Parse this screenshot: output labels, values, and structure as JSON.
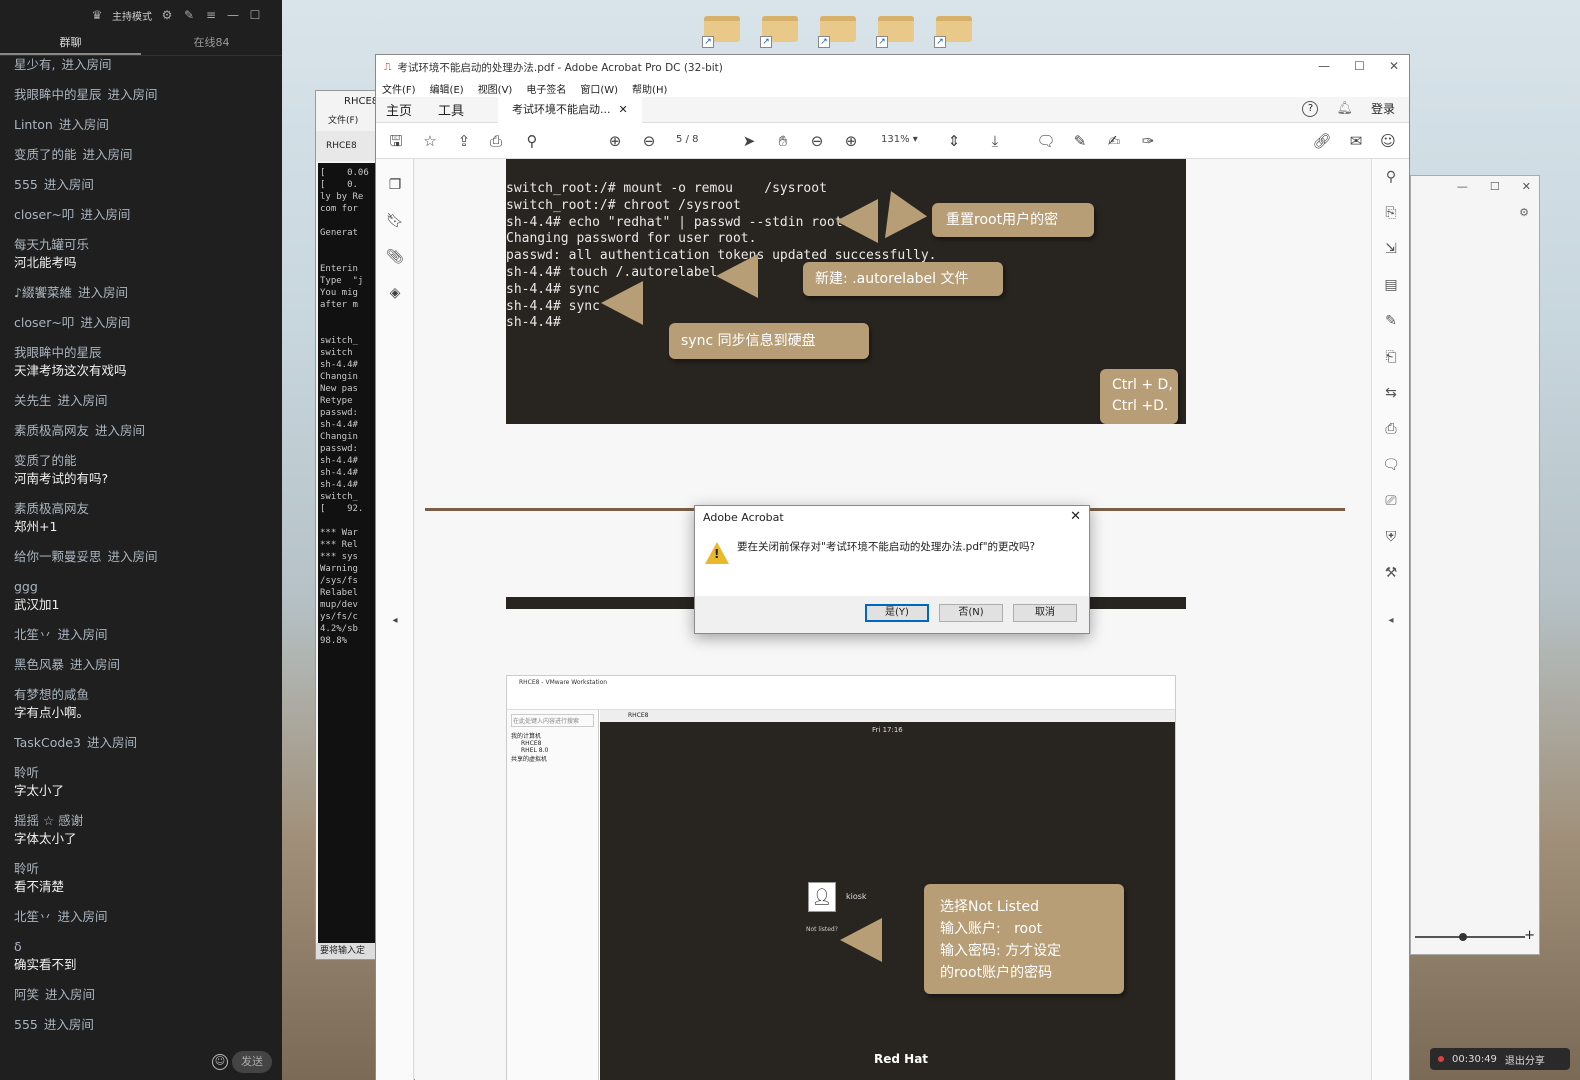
{
  "chat": {
    "header_label": "主持模式",
    "tabs": [
      {
        "label": "群聊",
        "active": true
      },
      {
        "label": "在线84",
        "active": false
      }
    ],
    "messages": [
      {
        "nick": "星少有,",
        "action": "进入房间",
        "text": ""
      },
      {
        "nick": "我眼眸中的星辰",
        "action": "进入房间",
        "text": ""
      },
      {
        "nick": "Linton",
        "action": "进入房间",
        "text": ""
      },
      {
        "nick": "变质了的能",
        "action": "进入房间",
        "text": ""
      },
      {
        "nick": "555",
        "action": "进入房间",
        "text": ""
      },
      {
        "nick": "closer~叩",
        "action": "进入房间",
        "text": ""
      },
      {
        "nick": "每天九罐可乐",
        "action": "",
        "text": "河北能考吗"
      },
      {
        "nick": "♪綴饗菜維",
        "action": "进入房间",
        "text": ""
      },
      {
        "nick": "closer~叩",
        "action": "进入房间",
        "text": ""
      },
      {
        "nick": "我眼眸中的星辰",
        "action": "",
        "text": "天津考场这次有戏吗"
      },
      {
        "nick": "关先生",
        "action": "进入房间",
        "text": ""
      },
      {
        "nick": "素质极高网友",
        "action": "进入房间",
        "text": ""
      },
      {
        "nick": "变质了的能",
        "action": "",
        "text": "河南考试的有吗?"
      },
      {
        "nick": "素质极高网友",
        "action": "",
        "text": "郑州+1"
      },
      {
        "nick": "给你一颗曼妥思",
        "action": "进入房间",
        "text": ""
      },
      {
        "nick": "ggg",
        "action": "",
        "text": "武汉加1"
      },
      {
        "nick": "北笙丷",
        "action": "进入房间",
        "text": ""
      },
      {
        "nick": "黑色风暴",
        "action": "进入房间",
        "text": ""
      },
      {
        "nick": "有梦想的咸鱼",
        "action": "",
        "text": "字有点小啊。"
      },
      {
        "nick": "TaskCode3",
        "action": "进入房间",
        "text": ""
      },
      {
        "nick": "聆听",
        "action": "",
        "text": "字太小了"
      },
      {
        "nick": "摇摇 ☆ 感谢",
        "action": "",
        "text": "字体太小了"
      },
      {
        "nick": "聆听",
        "action": "",
        "text": "看不清楚"
      },
      {
        "nick": "北笙丷",
        "action": "进入房间",
        "text": ""
      },
      {
        "nick": "δ",
        "action": "",
        "text": "确实看不到"
      },
      {
        "nick": "阿笑",
        "action": "进入房间",
        "text": ""
      },
      {
        "nick": "555",
        "action": "进入房间",
        "text": ""
      }
    ],
    "send_label": "发送"
  },
  "bg_window": {
    "title": "RHCE8",
    "menu": "文件(F)",
    "tab": "RHCE8",
    "terminal": "[    0.06\n[    0.\nly by Re\ncom for\n\nGenerat\n\n\nEnterin\nType  \"j\nYou mig\nafter m\n\n\nswitch_\nswitch \nsh-4.4#\nChangin\nNew pas\nRetype \npasswd:\nsh-4.4#\nChangin\npasswd:\nsh-4.4#\nsh-4.4#\nsh-4.4#\nswitch_\n[    92.\n\n*** War\n*** Rel\n*** sys\nWarning\n/sys/fs\nRelabel\nmup/dev\nys/fs/c\n4.2%/sb\n98.8%",
    "status": "要将输入定"
  },
  "acrobat": {
    "title": "考试环境不能启动的处理办法.pdf - Adobe Acrobat Pro DC (32-bit)",
    "menus": [
      "文件(F)",
      "编辑(E)",
      "视图(V)",
      "电子签名",
      "窗口(W)",
      "帮助(H)"
    ],
    "main_tabs": [
      "主页",
      "工具"
    ],
    "doc_tab": "考试环境不能启动...",
    "login": "登录",
    "page_current": "5",
    "page_total": "/ 8",
    "zoom": "131%",
    "slide1_code": "switch_root:/# mount -o remou    /sysroot\nswitch_root:/# chroot /sysroot\nsh-4.4# echo \"redhat\" | passwd --stdin root\nChanging password for user root.\npasswd: all authentication tokens updated successfully.\nsh-4.4# touch /.autorelabel\nsh-4.4# sync\nsh-4.4# sync\nsh-4.4#",
    "callout_reset": "重置root用户的密",
    "callout_touch": "新建: .autorelabel 文件",
    "callout_sync": "sync 同步信息到硬盘",
    "callout_ctrl": "Ctrl + D,\nCtrl +D.",
    "vm_title": "RHCE8 - VMware Workstation",
    "vm_tab": "RHCE8",
    "vm_clock": "Fri 17:16",
    "vm_tree": [
      "我的计算机",
      "RHCE8",
      "RHEL 8.0",
      "共享的虚拟机"
    ],
    "vm_search": "在此处键入内容进行搜索",
    "vm_user": "kiosk",
    "vm_notlisted": "Not listed?",
    "vm_brand": "Red Hat",
    "callout_login": "选择Not Listed\n输入账户:   root\n输入密码: 方才设定\n的root账户的密码"
  },
  "dialog": {
    "title": "Adobe Acrobat",
    "message": "要在关闭前保存对\"考试环境不能启动的处理办法.pdf\"的更改吗?",
    "yes": "是(Y)",
    "no": "否(N)",
    "cancel": "取消"
  },
  "sharebar": {
    "time": "00:30:49",
    "exit": "退出分享"
  },
  "colors": {
    "callout": "#b79e76",
    "chat_bg": "#1f1f1f",
    "terminal_bg": "#282520",
    "warning": "#e9b92b"
  }
}
